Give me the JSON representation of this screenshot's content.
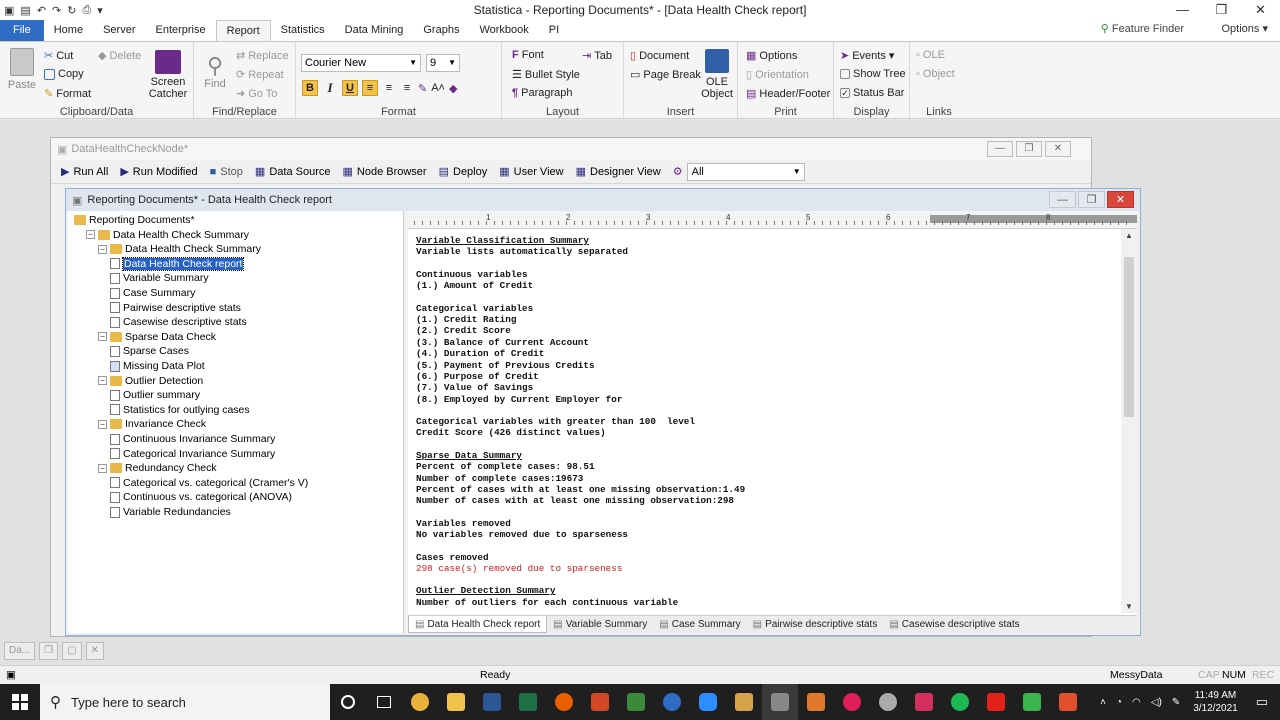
{
  "window": {
    "title": "Statistica - Reporting Documents* - [Data Health Check report]",
    "controls": [
      "—",
      "❐",
      "✕"
    ]
  },
  "ribbon_tabs": [
    "File",
    "Home",
    "Server",
    "Enterprise",
    "Report",
    "Statistics",
    "Data Mining",
    "Graphs",
    "Workbook",
    "PI"
  ],
  "active_tab": "Report",
  "feature_finder": "Feature Finder",
  "options": "Options",
  "ribbon": {
    "clipboard": {
      "label": "Clipboard/Data",
      "paste": "Paste",
      "cut": "Cut",
      "copy": "Copy",
      "format": "Format",
      "delete": "Delete",
      "screen_catcher_1": "Screen",
      "screen_catcher_2": "Catcher"
    },
    "find": {
      "label": "Find/Replace",
      "find": "Find",
      "replace": "Replace",
      "repeat": "Repeat",
      "goto": "Go To"
    },
    "format": {
      "label": "Format",
      "font": "Courier New",
      "size": "9",
      "bold": "B",
      "italic": "I",
      "underline": "U"
    },
    "layout": {
      "label": "Layout",
      "font": "Font",
      "tab": "Tab",
      "bullet": "Bullet Style",
      "paragraph": "Paragraph"
    },
    "insert": {
      "label": "Insert",
      "document": "Document",
      "page_break": "Page Break",
      "ole_1": "OLE",
      "ole_2": "Object"
    },
    "print": {
      "label": "Print",
      "options": "Options",
      "orientation": "Orientation",
      "header_footer": "Header/Footer"
    },
    "display": {
      "label": "Display",
      "events": "Events",
      "show_tree": "Show Tree",
      "status_bar": "Status Bar"
    },
    "links": {
      "label": "Links",
      "ole": "OLE",
      "object": "Object"
    }
  },
  "node_window": {
    "title": "DataHealthCheckNode*",
    "toolbar": {
      "run_all": "Run All",
      "run_modified": "Run Modified",
      "stop": "Stop",
      "data_source": "Data Source",
      "node_browser": "Node Browser",
      "deploy": "Deploy",
      "user_view": "User View",
      "designer_view": "Designer View",
      "filter": "All"
    }
  },
  "report_window": {
    "title": "Reporting Documents* - Data Health Check report"
  },
  "tree": [
    {
      "label": "Reporting Documents*",
      "level": 0,
      "kind": "folder",
      "expander": ""
    },
    {
      "label": "Data Health Check Summary",
      "level": 1,
      "kind": "folder",
      "expander": "−"
    },
    {
      "label": "Data Health Check Summary",
      "level": 2,
      "kind": "folder",
      "expander": "−"
    },
    {
      "label": "Data Health Check report",
      "level": 3,
      "kind": "doc",
      "selected": true
    },
    {
      "label": "Variable Summary",
      "level": 3,
      "kind": "doc"
    },
    {
      "label": "Case Summary",
      "level": 3,
      "kind": "doc"
    },
    {
      "label": "Pairwise descriptive stats",
      "level": 3,
      "kind": "doc"
    },
    {
      "label": "Casewise descriptive stats",
      "level": 3,
      "kind": "doc"
    },
    {
      "label": "Sparse Data Check",
      "level": 2,
      "kind": "folder",
      "expander": "−"
    },
    {
      "label": "Sparse Cases",
      "level": 3,
      "kind": "doc"
    },
    {
      "label": "Missing Data Plot",
      "level": 3,
      "kind": "graph"
    },
    {
      "label": "Outlier Detection",
      "level": 2,
      "kind": "folder",
      "expander": "−"
    },
    {
      "label": "Outlier summary",
      "level": 3,
      "kind": "doc"
    },
    {
      "label": "Statistics for outlying cases",
      "level": 3,
      "kind": "doc"
    },
    {
      "label": "Invariance Check",
      "level": 2,
      "kind": "folder",
      "expander": "−"
    },
    {
      "label": "Continuous Invariance Summary",
      "level": 3,
      "kind": "doc"
    },
    {
      "label": "Categorical Invariance Summary",
      "level": 3,
      "kind": "doc"
    },
    {
      "label": "Redundancy Check",
      "level": 2,
      "kind": "folder",
      "expander": "−"
    },
    {
      "label": "Categorical vs. categorical (Cramer's V)",
      "level": 3,
      "kind": "doc"
    },
    {
      "label": "Continuous vs. categorical (ANOVA)",
      "level": 3,
      "kind": "doc"
    },
    {
      "label": "Variable Redundancies",
      "level": 3,
      "kind": "doc"
    }
  ],
  "ruler_numbers": [
    "1",
    "2",
    "3",
    "4",
    "5",
    "6",
    "7",
    "8"
  ],
  "document_lines": [
    {
      "t": "Variable Classification Summary",
      "s": "h"
    },
    {
      "t": "Variable lists automatically separated",
      "s": "b"
    },
    {
      "t": "",
      "s": "gap"
    },
    {
      "t": "Continuous variables",
      "s": "b"
    },
    {
      "t": "(1.) Amount of Credit",
      "s": "b"
    },
    {
      "t": "",
      "s": "gap"
    },
    {
      "t": "Categorical variables",
      "s": "b"
    },
    {
      "t": "(1.) Credit Rating",
      "s": "b"
    },
    {
      "t": "(2.) Credit Score",
      "s": "b"
    },
    {
      "t": "(3.) Balance of Current Account",
      "s": "b"
    },
    {
      "t": "(4.) Duration of Credit",
      "s": "b"
    },
    {
      "t": "(5.) Payment of Previous Credits",
      "s": "b"
    },
    {
      "t": "(6.) Purpose of Credit",
      "s": "b"
    },
    {
      "t": "(7.) Value of Savings",
      "s": "b"
    },
    {
      "t": "(8.) Employed by Current Employer for",
      "s": "b"
    },
    {
      "t": "",
      "s": "gap"
    },
    {
      "t": "Categorical variables with greater than 100  level",
      "s": "b"
    },
    {
      "t": "Credit Score (426 distinct values)",
      "s": "b"
    },
    {
      "t": "",
      "s": "gap"
    },
    {
      "t": "Sparse Data Summary",
      "s": "h"
    },
    {
      "t": "Percent of complete cases: 98.51",
      "s": "b"
    },
    {
      "t": "Number of complete cases:19673",
      "s": "b"
    },
    {
      "t": "Percent of cases with at least one missing observation:1.49",
      "s": "b"
    },
    {
      "t": "Number of cases with at least one missing observation:298",
      "s": "b"
    },
    {
      "t": "",
      "s": "gap"
    },
    {
      "t": "Variables removed",
      "s": "b"
    },
    {
      "t": "No variables removed due to sparseness",
      "s": "b"
    },
    {
      "t": "",
      "s": "gap"
    },
    {
      "t": "Cases removed",
      "s": "b"
    },
    {
      "t": "298 case(s) removed due to sparseness",
      "s": "red"
    },
    {
      "t": "",
      "s": "gap"
    },
    {
      "t": "Outlier Detection Summary",
      "s": "h"
    },
    {
      "t": "Number of outliers for each continuous variable",
      "s": "b"
    }
  ],
  "doc_tabs": [
    "Data Health Check report",
    "Variable Summary",
    "Case Summary",
    "Pairwise descriptive stats",
    "Casewise descriptive stats"
  ],
  "minimized": "Da...",
  "status": {
    "ready": "Ready",
    "user": "MessyData",
    "cap": "CAP",
    "num": "NUM",
    "rec": "REC"
  },
  "taskbar": {
    "search_placeholder": "Type here to search",
    "time": "11:49 AM",
    "date": "3/12/2021"
  },
  "colors": {
    "accent": "#2f6dc4",
    "selection": "#2962c5",
    "red_text": "#d42020"
  }
}
